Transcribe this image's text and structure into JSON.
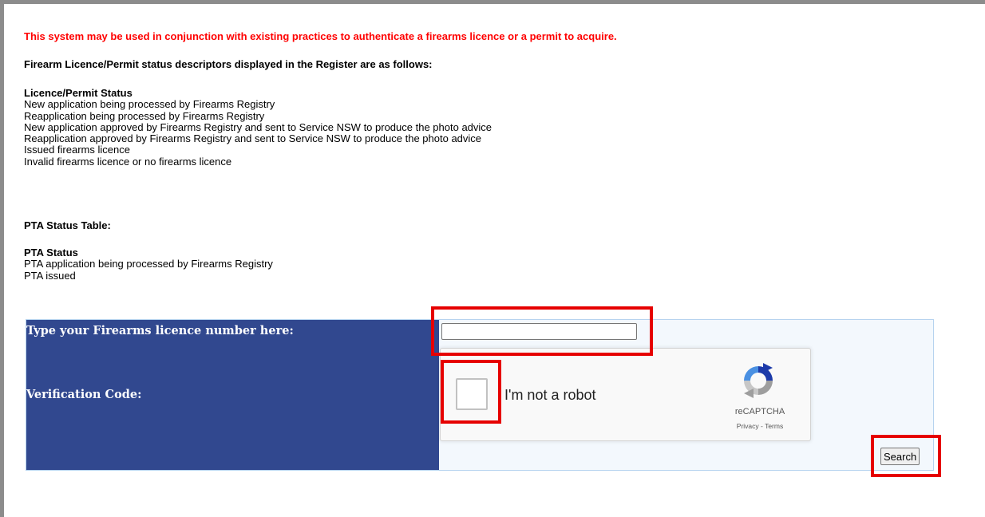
{
  "intro": {
    "warning": "This system may be used in conjunction with existing practices to authenticate a firearms licence or a permit to acquire.",
    "descriptors_heading": "Firearm Licence/Permit status descriptors displayed in the Register are as follows:"
  },
  "licence_status": {
    "heading": "Licence/Permit Status",
    "items": [
      "New application being processed by Firearms Registry",
      "Reapplication being processed by Firearms Registry",
      "New application approved by Firearms Registry and sent to Service NSW to produce the photo advice",
      "Reapplication approved by Firearms Registry and sent to Service NSW to produce the photo advice",
      "Issued firearms licence",
      "Invalid firearms licence or no firearms licence"
    ]
  },
  "pta": {
    "table_title": "PTA Status Table:",
    "heading": "PTA Status",
    "items": [
      "PTA application being processed by Firearms Registry",
      "PTA issued"
    ]
  },
  "form": {
    "licence_label": "Type your Firearms licence number here:",
    "licence_value": "",
    "verification_label": "Verification Code:",
    "recaptcha_label": "I'm not a robot",
    "recaptcha_brand": "reCAPTCHA",
    "recaptcha_links": "Privacy - Terms",
    "search_label": "Search"
  },
  "colors": {
    "warning": "#ff0000",
    "panel": "#31488f",
    "highlight": "#e60000"
  }
}
